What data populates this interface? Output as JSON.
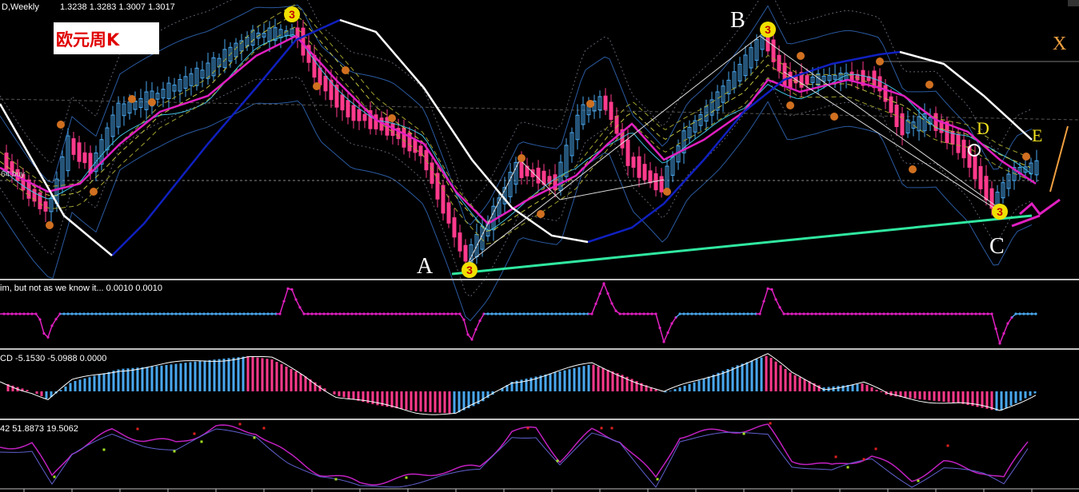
{
  "header": {
    "symbol_period": "D,Weekly",
    "ohlc": "1.3238 1.3283 1.3007 1.3017",
    "chart_title": "欧元周K",
    "buy_line_label": "64 buy"
  },
  "sub_panels": [
    {
      "header": "im, but not as we know it... 0.0010 0.0010"
    },
    {
      "header": "CD -5.1530 -5.0988 0.0000"
    },
    {
      "header": "42 51.8873 19.5062"
    }
  ],
  "wave_labels": {
    "A": "A",
    "B": "B",
    "C": "C",
    "D": "D",
    "E": "E",
    "X": "X"
  },
  "markers": {
    "three": "3",
    "one": "1"
  },
  "colors": {
    "bull": "#4aa8f0",
    "bear": "#ff3a8c",
    "magenta": "#e020c0",
    "blue": "#1020c0",
    "white": "#ffffff",
    "trend": "#30e8a0",
    "wave_letter": "#ffffff",
    "wave_letter_yellow": "#f0e020",
    "x_label": "#f0a040",
    "marker_three": "#f0e000",
    "marker_one": "#d07020"
  }
}
